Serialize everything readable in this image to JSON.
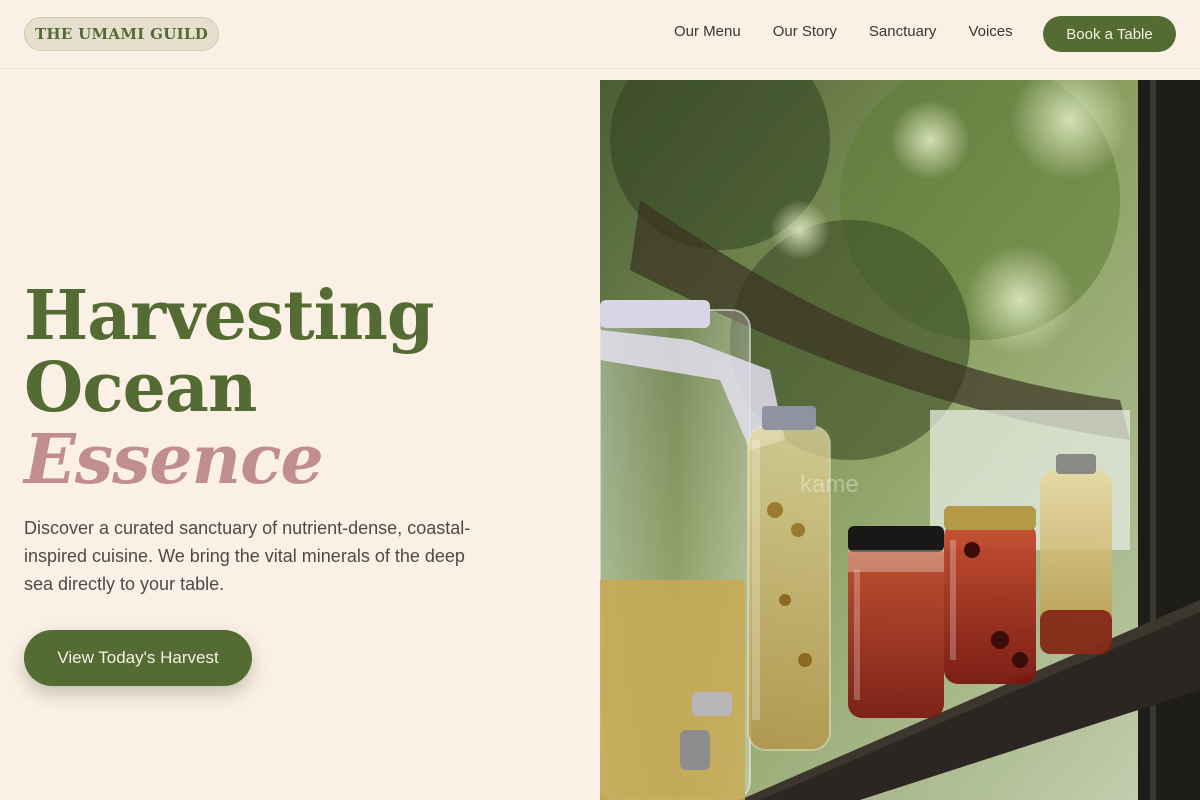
{
  "header": {
    "logo": "THE UMAMI GUILD",
    "nav": [
      "Our Menu",
      "Our Story",
      "Sanctuary",
      "Voices"
    ],
    "cta": "Book a Table"
  },
  "hero": {
    "title_line1": "Harvesting",
    "title_line2": "Ocean",
    "title_accent": "Essence",
    "description": "Discover a curated sanctuary of nutrient-dense, coastal-inspired cuisine. We bring the vital minerals of the deep sea directly to your table.",
    "cta": "View Today's Harvest"
  },
  "colors": {
    "background": "#fbf0e6",
    "brand_green": "#556b34",
    "accent_rose": "#c08f8d",
    "logo_pill": "#e4e0cd"
  },
  "photo": {
    "icon": "fermented-drinks-jars-photo",
    "watermark": "kame"
  }
}
